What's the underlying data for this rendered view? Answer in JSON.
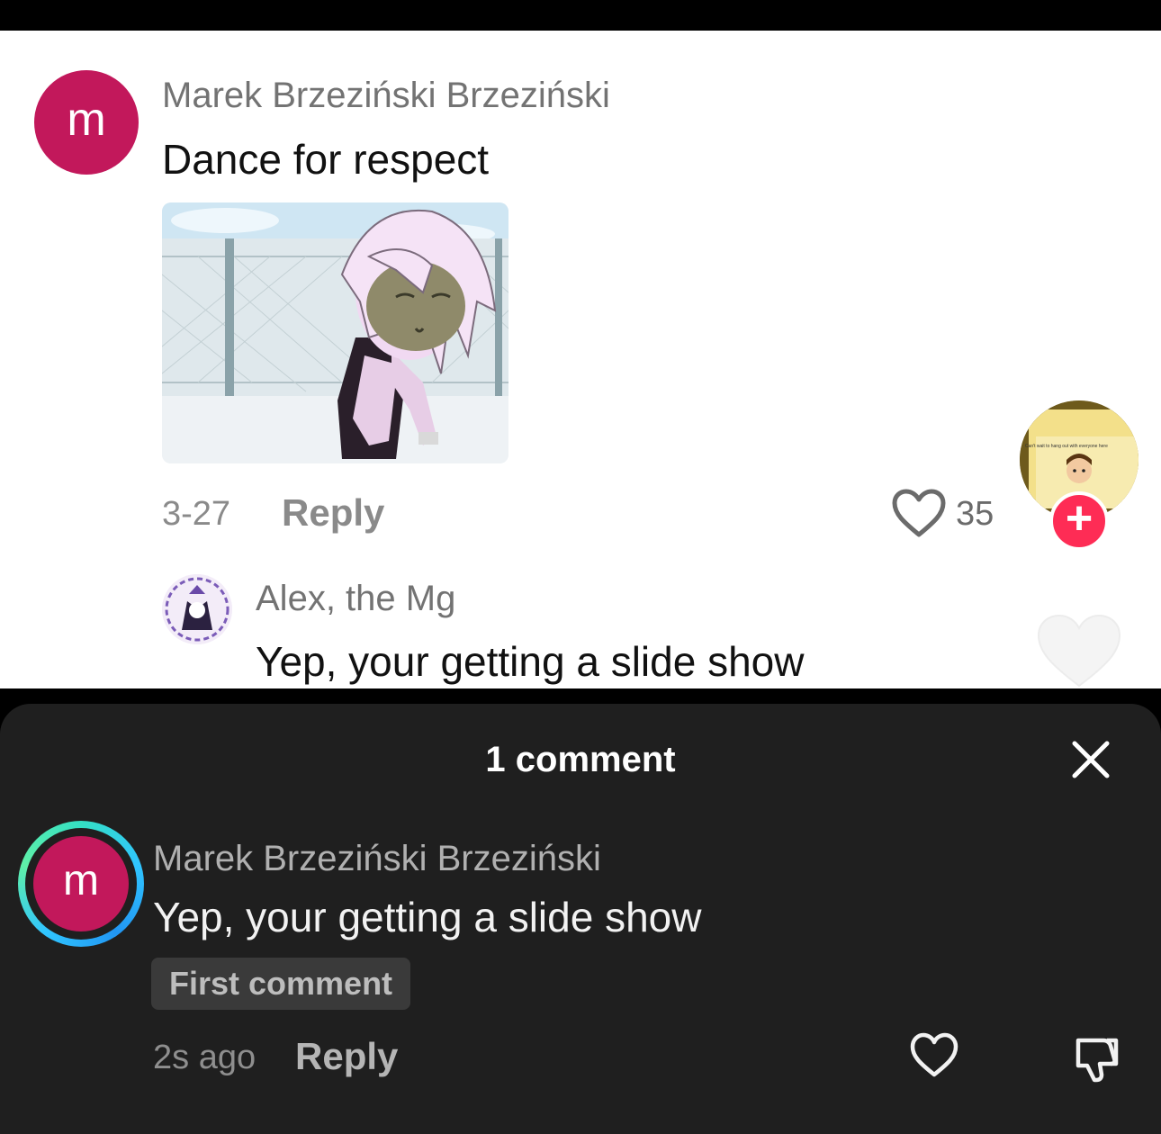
{
  "upper": {
    "comment1": {
      "avatar_letter": "m",
      "username": "Marek Brzeziński Brzeziński",
      "text": "Dance for respect",
      "date": "3-27",
      "reply_label": "Reply",
      "like_count": "35"
    },
    "floating_video": {
      "caption": "Can't wait to hang out with everyone here"
    },
    "comment2": {
      "username": "Alex, the Mg",
      "text": "Yep, your getting a slide show"
    }
  },
  "sheet": {
    "title": "1 comment",
    "comment": {
      "avatar_letter": "m",
      "username": "Marek Brzeziński Brzeziński",
      "text": "Yep, your getting a slide show",
      "badge": "First comment",
      "time": "2s ago",
      "reply_label": "Reply"
    }
  },
  "colors": {
    "avatar_bg": "#c2185b",
    "plus_button": "#fe2c55",
    "sheet_bg": "#1f1f1f",
    "ring_gradient": [
      "#34e0c4",
      "#30c5ff",
      "#2196f3"
    ]
  }
}
